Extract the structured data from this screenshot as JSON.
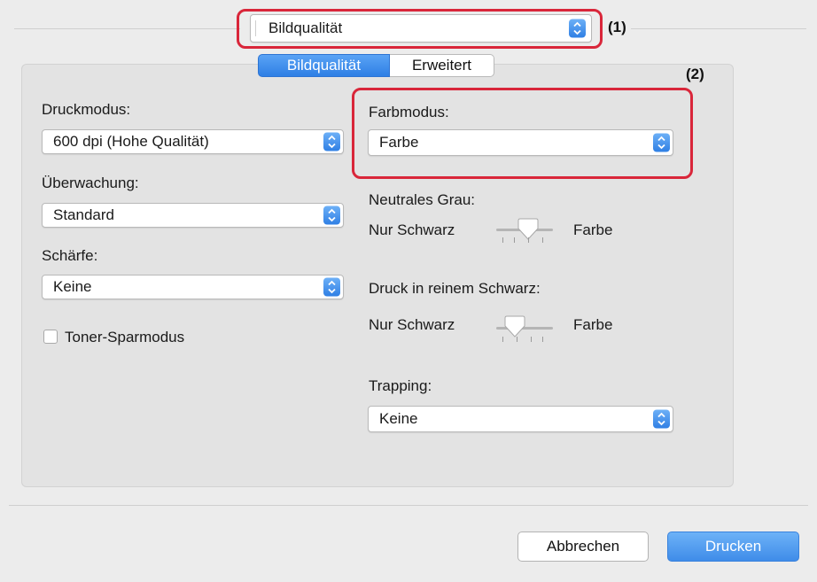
{
  "header": {
    "panel_select": {
      "value": "Bildqualität"
    },
    "callout_1": "(1)",
    "callout_2": "(2)"
  },
  "tabs": [
    {
      "label": "Bildqualität",
      "selected": true
    },
    {
      "label": "Erweitert",
      "selected": false
    }
  ],
  "left": {
    "druckmodus": {
      "label": "Druckmodus:",
      "value": "600 dpi (Hohe Qualität)"
    },
    "ueberwachung": {
      "label": "Überwachung:",
      "value": "Standard"
    },
    "schaerfe": {
      "label": "Schärfe:",
      "value": "Keine"
    },
    "toner": {
      "label": "Toner-Sparmodus",
      "checked": false
    }
  },
  "right": {
    "farbmodus": {
      "label": "Farbmodus:",
      "value": "Farbe"
    },
    "neutrales_grau": {
      "label": "Neutrales Grau:",
      "left": "Nur Schwarz",
      "right": "Farbe"
    },
    "reines_schwarz": {
      "label": "Druck in reinem Schwarz:",
      "left": "Nur Schwarz",
      "right": "Farbe"
    },
    "trapping": {
      "label": "Trapping:",
      "value": "Keine"
    }
  },
  "footer": {
    "cancel": "Abbrechen",
    "print": "Drucken"
  },
  "colors": {
    "highlight": "#d9263a",
    "accent": "#2f7fe4"
  }
}
